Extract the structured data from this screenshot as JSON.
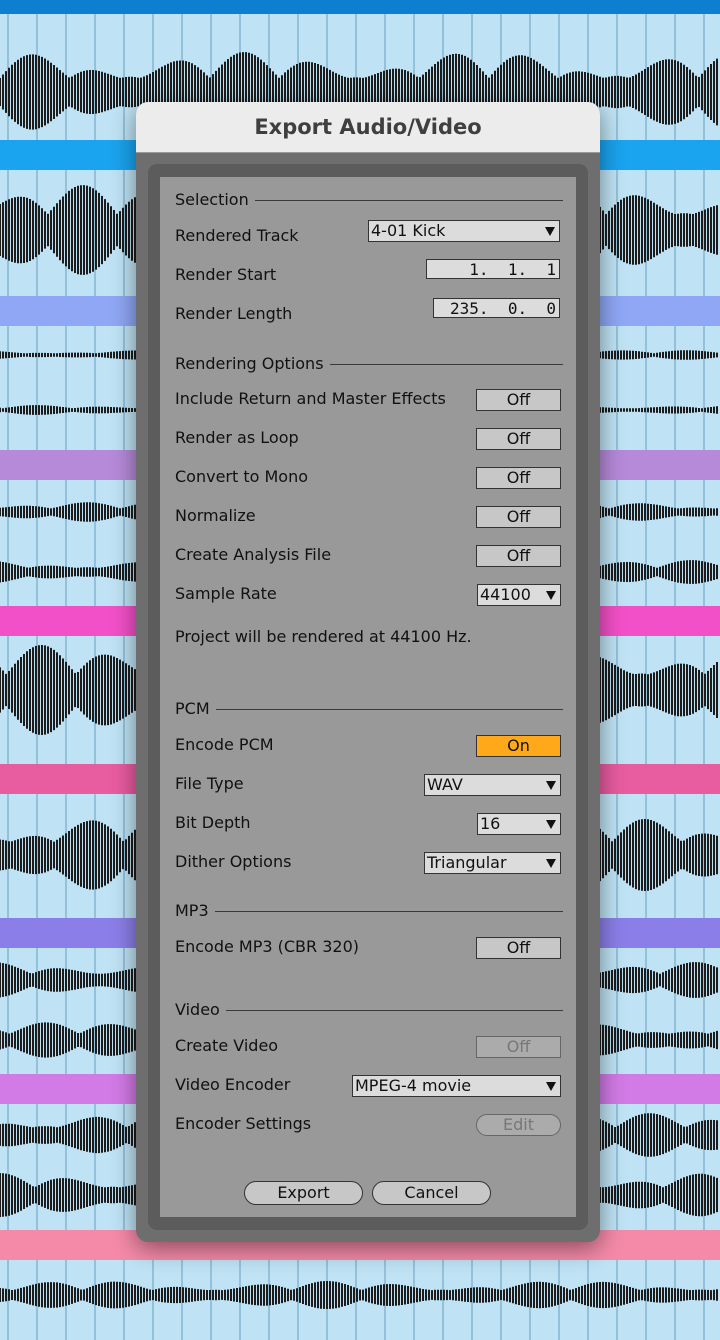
{
  "dialog": {
    "title": "Export Audio/Video",
    "selection": {
      "section_title": "Selection",
      "rendered_track_label": "Rendered Track",
      "rendered_track_value": "4-01 Kick",
      "render_start_label": "Render Start",
      "render_start_value": "1.  1.  1",
      "render_length_label": "Render Length",
      "render_length_value": "235.  0.  0"
    },
    "rendering": {
      "section_title": "Rendering Options",
      "include_return_label": "Include Return and Master Effects",
      "include_return_value": "Off",
      "render_loop_label": "Render as Loop",
      "render_loop_value": "Off",
      "mono_label": "Convert to Mono",
      "mono_value": "Off",
      "normalize_label": "Normalize",
      "normalize_value": "Off",
      "analysis_label": "Create Analysis File",
      "analysis_value": "Off",
      "sample_rate_label": "Sample Rate",
      "sample_rate_value": "44100",
      "note": "Project will be rendered at 44100 Hz."
    },
    "pcm": {
      "section_title": "PCM",
      "encode_label": "Encode PCM",
      "encode_value": "On",
      "file_type_label": "File Type",
      "file_type_value": "WAV",
      "bit_depth_label": "Bit Depth",
      "bit_depth_value": "16",
      "dither_label": "Dither Options",
      "dither_value": "Triangular"
    },
    "mp3": {
      "section_title": "MP3",
      "encode_label": "Encode MP3 (CBR 320)",
      "encode_value": "Off"
    },
    "video": {
      "section_title": "Video",
      "create_label": "Create Video",
      "create_value": "Off",
      "encoder_label": "Video Encoder",
      "encoder_value": "MPEG-4 movie",
      "settings_label": "Encoder Settings",
      "settings_button": "Edit"
    },
    "buttons": {
      "export": "Export",
      "cancel": "Cancel"
    },
    "colors": {
      "on": "#ffa91a",
      "panel": "#999999",
      "frame": "#5c5c5c"
    },
    "icons": {
      "dropdown": "triangle-down"
    }
  },
  "background": {
    "description_free": true,
    "track_colors": [
      "#0e7fd0",
      "#1aa3ee",
      "#8fa7f5",
      "#b68ad9",
      "#f250c8",
      "#e85ca0",
      "#8c7ee8",
      "#d27ae6",
      "#f48aa8"
    ]
  }
}
